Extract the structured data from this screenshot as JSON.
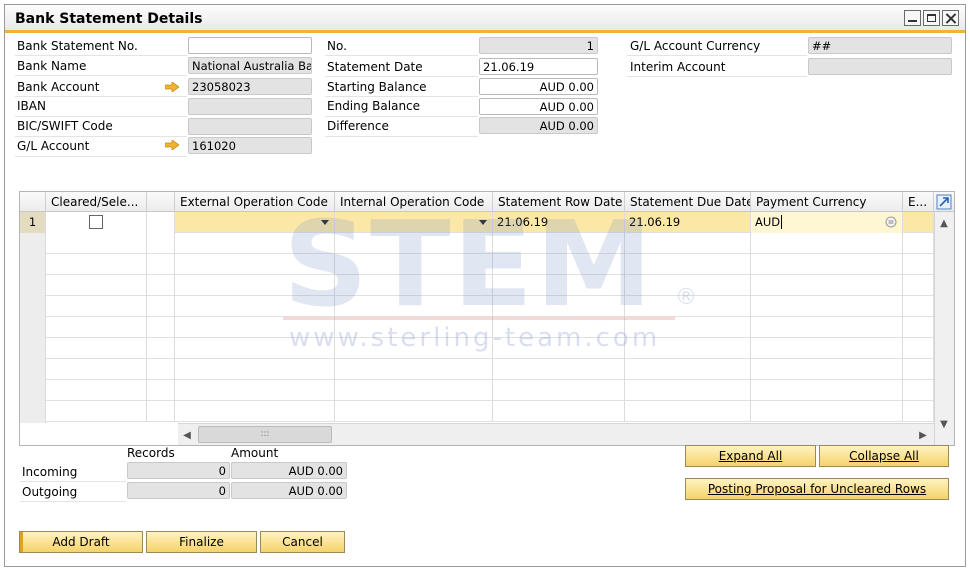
{
  "window": {
    "title": "Bank Statement Details"
  },
  "header": {
    "bank_statement_no": {
      "label": "Bank Statement No.",
      "value": ""
    },
    "bank_name": {
      "label": "Bank Name",
      "value": "National Australia Ba"
    },
    "bank_account": {
      "label": "Bank Account",
      "value": "23058023"
    },
    "iban": {
      "label": "IBAN",
      "value": ""
    },
    "bic_swift": {
      "label": "BIC/SWIFT Code",
      "value": ""
    },
    "gl_account": {
      "label": "G/L Account",
      "value": "161020"
    },
    "no": {
      "label": "No.",
      "value": "1"
    },
    "statement_date": {
      "label": "Statement Date",
      "value": "21.06.19"
    },
    "starting_balance": {
      "label": "Starting Balance",
      "value": "AUD 0.00"
    },
    "ending_balance": {
      "label": "Ending Balance",
      "value": "AUD 0.00"
    },
    "difference": {
      "label": "Difference",
      "value": "AUD 0.00"
    },
    "gl_account_currency": {
      "label": "G/L Account Currency",
      "value": "##"
    },
    "interim_account": {
      "label": "Interim Account",
      "value": ""
    }
  },
  "grid": {
    "columns": [
      "Cleared/Sele...",
      "External Operation Code",
      "Internal Operation Code",
      "Statement Row Date",
      "Statement Due Date",
      "Payment Currency",
      "E..."
    ],
    "rows": [
      {
        "num": "1",
        "cleared": false,
        "ext": "",
        "int": "",
        "row_date": "21.06.19",
        "due_date": "21.06.19",
        "currency": "AUD"
      }
    ],
    "hscroll_thumb": ":::"
  },
  "watermark": {
    "brand": "STEM",
    "registered": "®",
    "url": "www.sterling-team.com"
  },
  "summary": {
    "records_label": "Records",
    "amount_label": "Amount",
    "incoming": {
      "label": "Incoming",
      "records": "0",
      "amount": "AUD 0.00"
    },
    "outgoing": {
      "label": "Outgoing",
      "records": "0",
      "amount": "AUD 0.00"
    }
  },
  "buttons": {
    "expand_all": "Expand All",
    "collapse_all": "Collapse All",
    "posting_proposal": "Posting Proposal for Uncleared Rows",
    "add_draft": "Add Draft",
    "finalize": "Finalize",
    "cancel": "Cancel"
  },
  "colors": {
    "accent": "#f2b233",
    "selected_row": "#fce8a6",
    "button": "#f6d36a"
  }
}
